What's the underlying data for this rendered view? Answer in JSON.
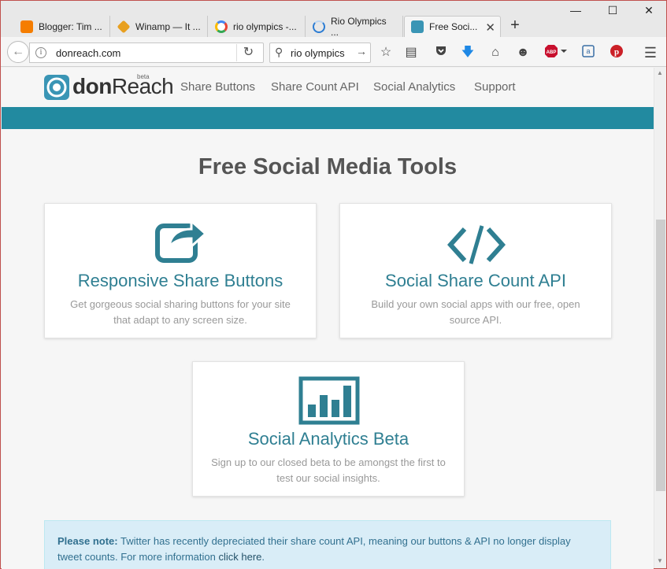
{
  "browser": {
    "tabs": [
      {
        "label": "Blogger: Tim ...",
        "icon": "blogger-icon",
        "color": "#f57d00"
      },
      {
        "label": "Winamp — It ...",
        "icon": "winamp-icon",
        "color": "#e8a020"
      },
      {
        "label": "rio olympics -...",
        "icon": "google-icon",
        "color": "#4285f4"
      },
      {
        "label": "Rio Olympics ...",
        "icon": "loading-icon",
        "color": "#2b7cd3"
      },
      {
        "label": "Free Soci...",
        "icon": "donreach-icon",
        "color": "#3a95b5",
        "active": true
      }
    ],
    "url": "donreach.com",
    "search_value": "rio olympics",
    "toolbar_icons": [
      "bookmark-star-icon",
      "reading-list-icon",
      "pocket-icon",
      "download-icon",
      "home-icon",
      "emoji-icon",
      "adblock-icon",
      "amazon-icon",
      "pinterest-icon",
      "menu-icon"
    ],
    "adblock_label": "ABP"
  },
  "site": {
    "logo_text_don": "don",
    "logo_text_reach": "Reach",
    "beta_label": "beta",
    "nav": [
      "Share Buttons",
      "Share Count API",
      "Social Analytics",
      "Support"
    ],
    "heading": "Free Social Media Tools",
    "cards": [
      {
        "title": "Responsive Share Buttons",
        "desc": "Get gorgeous social sharing buttons for your site that adapt to any screen size.",
        "icon": "share-icon"
      },
      {
        "title": "Social Share Count API",
        "desc": "Build your own social apps with our free, open source API.",
        "icon": "code-icon"
      },
      {
        "title": "Social Analytics Beta",
        "desc": "Sign up to our closed beta to be amongst the first to test our social insights.",
        "icon": "bar-chart-icon"
      }
    ],
    "note": {
      "label": "Please note:",
      "text": " Twitter has recently depreciated their share count API, meaning our buttons & API no longer display tweet counts. For more information ",
      "link": "click here",
      "end": "."
    },
    "accent": "#228aa0"
  }
}
